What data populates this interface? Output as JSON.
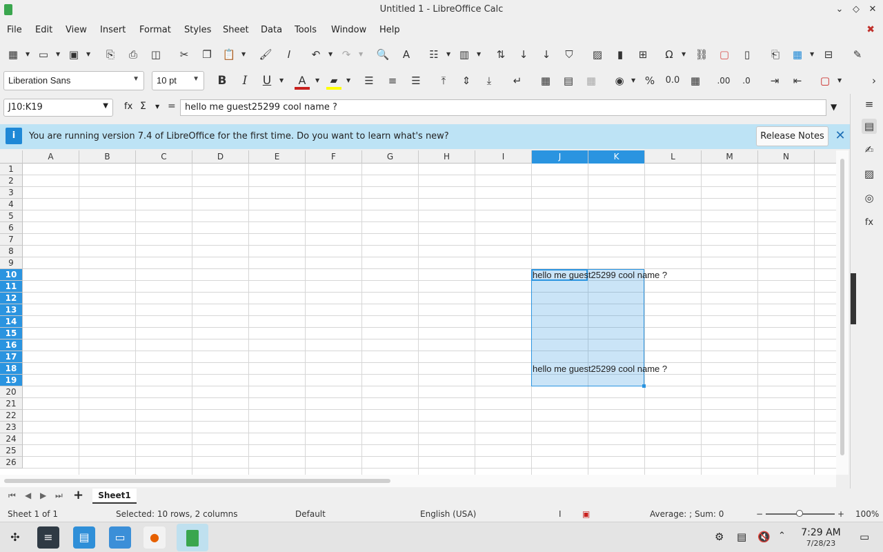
{
  "window": {
    "title": "Untitled 1 - LibreOffice Calc"
  },
  "menu": [
    "File",
    "Edit",
    "View",
    "Insert",
    "Format",
    "Styles",
    "Sheet",
    "Data",
    "Tools",
    "Window",
    "Help"
  ],
  "format_bar": {
    "font_name": "Liberation Sans",
    "font_size": "10 pt",
    "font_color": "#c9211e",
    "highlight_color": "#ffff00"
  },
  "formula_bar": {
    "name_box": "J10:K19",
    "content": "hello me guest25299 cool name ?",
    "fx": "fx",
    "sigma": "Σ",
    "equals": "="
  },
  "infobar": {
    "message": "You are running version 7.4 of LibreOffice for the first time. Do you want to learn what's new?",
    "button": "Release Notes",
    "close": "✕"
  },
  "grid": {
    "columns": [
      "A",
      "B",
      "C",
      "D",
      "E",
      "F",
      "G",
      "H",
      "I",
      "J",
      "K",
      "L",
      "M",
      "N"
    ],
    "selected_columns": [
      "J",
      "K"
    ],
    "rows": [
      "1",
      "2",
      "3",
      "4",
      "5",
      "6",
      "7",
      "8",
      "9",
      "10",
      "11",
      "12",
      "13",
      "14",
      "15",
      "16",
      "17",
      "18",
      "19",
      "20",
      "21",
      "22",
      "23",
      "24",
      "25",
      "26"
    ],
    "selected_rows": [
      "10",
      "11",
      "12",
      "13",
      "14",
      "15",
      "16",
      "17",
      "18",
      "19"
    ],
    "cells": [
      {
        "ref": "J10",
        "text": "hello me guest25299 cool name ?"
      },
      {
        "ref": "J18",
        "text": "hello me guest25299 cool name ?"
      }
    ]
  },
  "sheet_tabs": {
    "add": "+",
    "active": "Sheet1"
  },
  "status": {
    "sheet": "Sheet 1 of 1",
    "selection": "Selected: 10 rows, 2 columns",
    "style": "Default",
    "language": "English (USA)",
    "summary": "Average: ; Sum: 0",
    "zoom_minus": "−",
    "zoom_plus": "+",
    "zoom": "100%"
  },
  "taskbar": {
    "time": "7:29 AM",
    "date": "7/28/23"
  },
  "colors": {
    "accent": "#2a94e0",
    "infobar": "#bde3f5",
    "font_color": "#c9211e",
    "highlight": "#ffff00"
  }
}
